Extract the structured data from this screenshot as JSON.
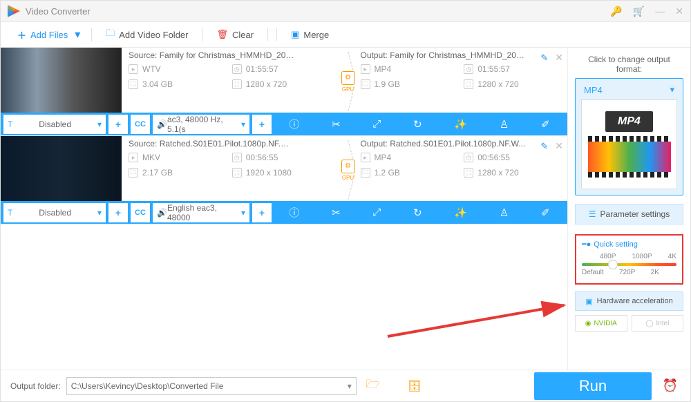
{
  "titlebar": {
    "title": "Video Converter"
  },
  "toolbar": {
    "add_files": "Add Files",
    "add_folder": "Add Video Folder",
    "clear": "Clear",
    "merge": "Merge"
  },
  "items": [
    {
      "source": {
        "title": "Source: Family for Christmas_HMMHD_2019_12...",
        "format": "WTV",
        "duration": "01:55:57",
        "size": "3.04 GB",
        "res": "1280 x 720"
      },
      "output": {
        "title": "Output: Family for Christmas_HMMHD_201...",
        "format": "MP4",
        "duration": "01:55:57",
        "size": "1.9 GB",
        "res": "1280 x 720"
      },
      "gpu": "GPU",
      "bar": {
        "subtitle": "Disabled",
        "audio": "ac3, 48000 Hz, 5.1(s"
      }
    },
    {
      "source": {
        "title": "Source: Ratched.S01E01.Pilot.1080p.NF.WEB-DL...",
        "format": "MKV",
        "duration": "00:56:55",
        "size": "2.17 GB",
        "res": "1920 x 1080"
      },
      "output": {
        "title": "Output: Ratched.S01E01.Pilot.1080p.NF.W...",
        "format": "MP4",
        "duration": "00:56:55",
        "size": "1.2 GB",
        "res": "1280 x 720"
      },
      "gpu": "GPU",
      "bar": {
        "subtitle": "Disabled",
        "audio": "English eac3, 48000"
      }
    }
  ],
  "sidebar": {
    "change_format_label": "Click to change output format:",
    "format_name": "MP4",
    "format_badge": "MP4",
    "param_settings": "Parameter settings",
    "quick_setting_label": "Quick setting",
    "qs_marks_top": [
      "480P",
      "1080P",
      "4K"
    ],
    "qs_marks_bottom": [
      "Default",
      "720P",
      "2K"
    ],
    "hw_accel": "Hardware acceleration",
    "nvidia": "NVIDIA",
    "intel": "Intel"
  },
  "bottom": {
    "label": "Output folder:",
    "path": "C:\\Users\\Kevincy\\Desktop\\Converted File",
    "run": "Run"
  }
}
